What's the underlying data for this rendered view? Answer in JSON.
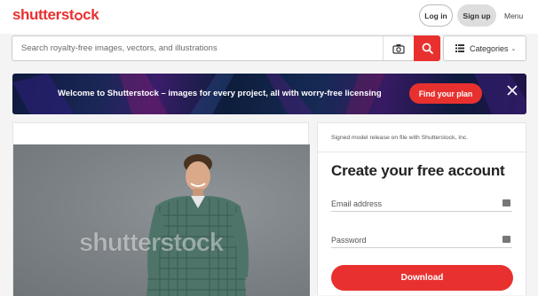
{
  "header": {
    "logo_text_1": "shutterst",
    "logo_text_2": "ck",
    "login_label": "Log in",
    "signup_label": "Sign up",
    "menu_label": "Menu"
  },
  "search": {
    "placeholder": "Search royalty-free images, vectors, and illustrations",
    "value": "",
    "categories_label": "Categories"
  },
  "banner": {
    "text": "Welcome to Shutterstock – images for every project, all with worry-free licensing",
    "cta_label": "Find your plan"
  },
  "image": {
    "watermark": "shutterstock"
  },
  "signup_panel": {
    "release_note": "Signed model release on file with Shutterstock, Inc.",
    "title": "Create your free account",
    "email_placeholder": "Email address",
    "password_placeholder": "Password",
    "download_label": "Download"
  },
  "colors": {
    "brand_red": "#e8312f",
    "banner_navy": "#0e1a3e"
  },
  "icons": [
    "camera-search-icon",
    "search-icon",
    "list-icon",
    "chevron-down-icon",
    "close-icon",
    "keyboard-icon"
  ]
}
